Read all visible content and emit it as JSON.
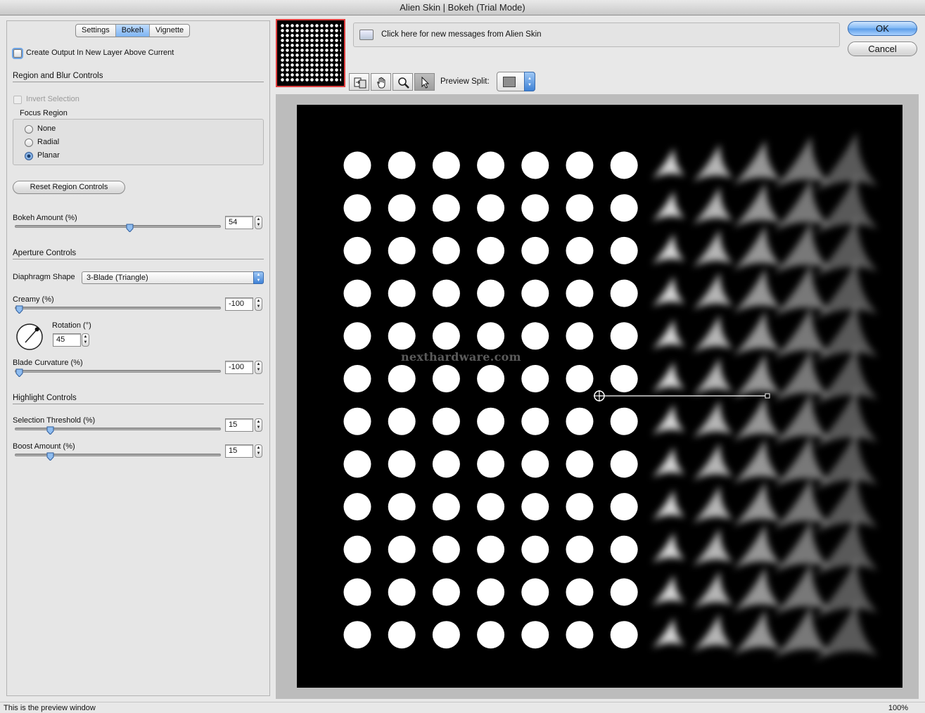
{
  "window": {
    "title": "Alien Skin | Bokeh (Trial Mode)"
  },
  "tabs": [
    {
      "label": "Settings",
      "active": false
    },
    {
      "label": "Bokeh",
      "active": true
    },
    {
      "label": "Vignette",
      "active": false
    }
  ],
  "options": {
    "create_output_label": "Create Output In New Layer Above Current",
    "create_output_checked": false
  },
  "region": {
    "heading": "Region and Blur Controls",
    "invert_label": "Invert Selection",
    "invert_checked": false,
    "focus_region_label": "Focus Region",
    "focus_options": [
      "None",
      "Radial",
      "Planar"
    ],
    "focus_selected": "Planar",
    "reset_label": "Reset Region Controls"
  },
  "bokeh_amount": {
    "label": "Bokeh Amount (%)",
    "value": "54",
    "fraction": 0.54
  },
  "aperture": {
    "heading": "Aperture Controls",
    "diaphragm_label": "Diaphragm Shape",
    "diaphragm_value": "3-Blade (Triangle)",
    "creamy_label": "Creamy (%)",
    "creamy_value": "-100",
    "creamy_fraction": 0.0,
    "rotation_label": "Rotation (°)",
    "rotation_value": "45",
    "blade_label": "Blade Curvature (%)",
    "blade_value": "-100",
    "blade_fraction": 0.0
  },
  "highlight": {
    "heading": "Highlight Controls",
    "threshold_label": "Selection Threshold (%)",
    "threshold_value": "15",
    "threshold_fraction": 0.15,
    "boost_label": "Boost Amount (%)",
    "boost_value": "15",
    "boost_fraction": 0.15
  },
  "messages": {
    "text": "Click here for new messages from Alien Skin"
  },
  "buttons": {
    "ok": "OK",
    "cancel": "Cancel"
  },
  "toolbar": {
    "tools": [
      "compare-icon",
      "hand-icon",
      "zoom-icon",
      "pointer-icon"
    ],
    "active_tool": "pointer-icon",
    "preview_split_label": "Preview Split:"
  },
  "preview": {
    "watermark": "nexthardware.com",
    "grid_rows": 12,
    "grid_cols": 12,
    "sharp_cols": 7
  },
  "status": {
    "left": "This is the preview window",
    "zoom": "100%"
  }
}
